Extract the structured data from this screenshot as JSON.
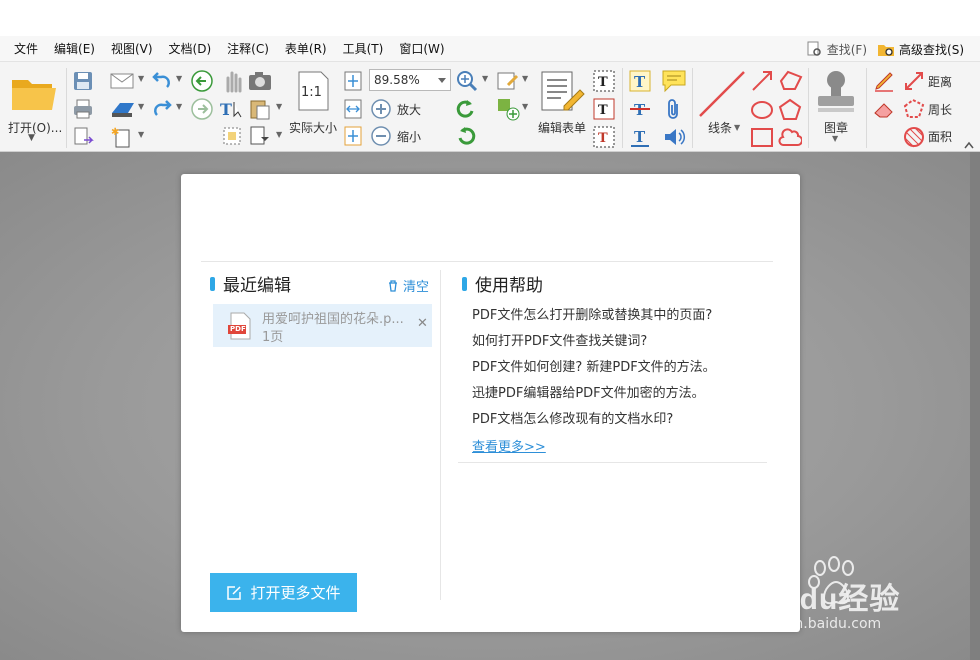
{
  "menu": {
    "items": [
      "文件",
      "编辑(E)",
      "视图(V)",
      "文档(D)",
      "注释(C)",
      "表单(R)",
      "工具(T)",
      "窗口(W)"
    ],
    "find": "查找(F)",
    "advanced_find": "高级查找(S)"
  },
  "toolbar": {
    "open_label": "打开(O)...",
    "actual_size_label": "实际大小",
    "zoom_value": "89.58%",
    "zoom_in_label": "放大",
    "zoom_out_label": "缩小",
    "edit_form_label": "编辑表单",
    "lines_label": "线条",
    "stamp_label": "图章",
    "distance_label": "距离",
    "perimeter_label": "周长",
    "area_label": "面积",
    "actual_size_glyph": "1:1"
  },
  "recent": {
    "title": "最近编辑",
    "clear_label": "清空",
    "items": [
      {
        "name": "用爱呵护祖国的花朵.p...",
        "pages": "1页",
        "badge": "PDF"
      }
    ]
  },
  "help": {
    "title": "使用帮助",
    "questions": [
      "PDF文件怎么打开删除或替换其中的页面?",
      "如何打开PDF文件查找关键词?",
      "PDF文件如何创建? 新建PDF文件的方法。",
      "迅捷PDF编辑器给PDF文件加密的方法。",
      "PDF文档怎么修改现有的文档水印?"
    ],
    "more_label": "查看更多>>"
  },
  "open_more_label": "打开更多文件",
  "watermark": {
    "brand": "Baidu经验",
    "url": "jingyan.baidu.com"
  },
  "colors": {
    "accent": "#3bb3ec",
    "link": "#2e8fd8",
    "selected_bg": "#e5f1fb"
  }
}
